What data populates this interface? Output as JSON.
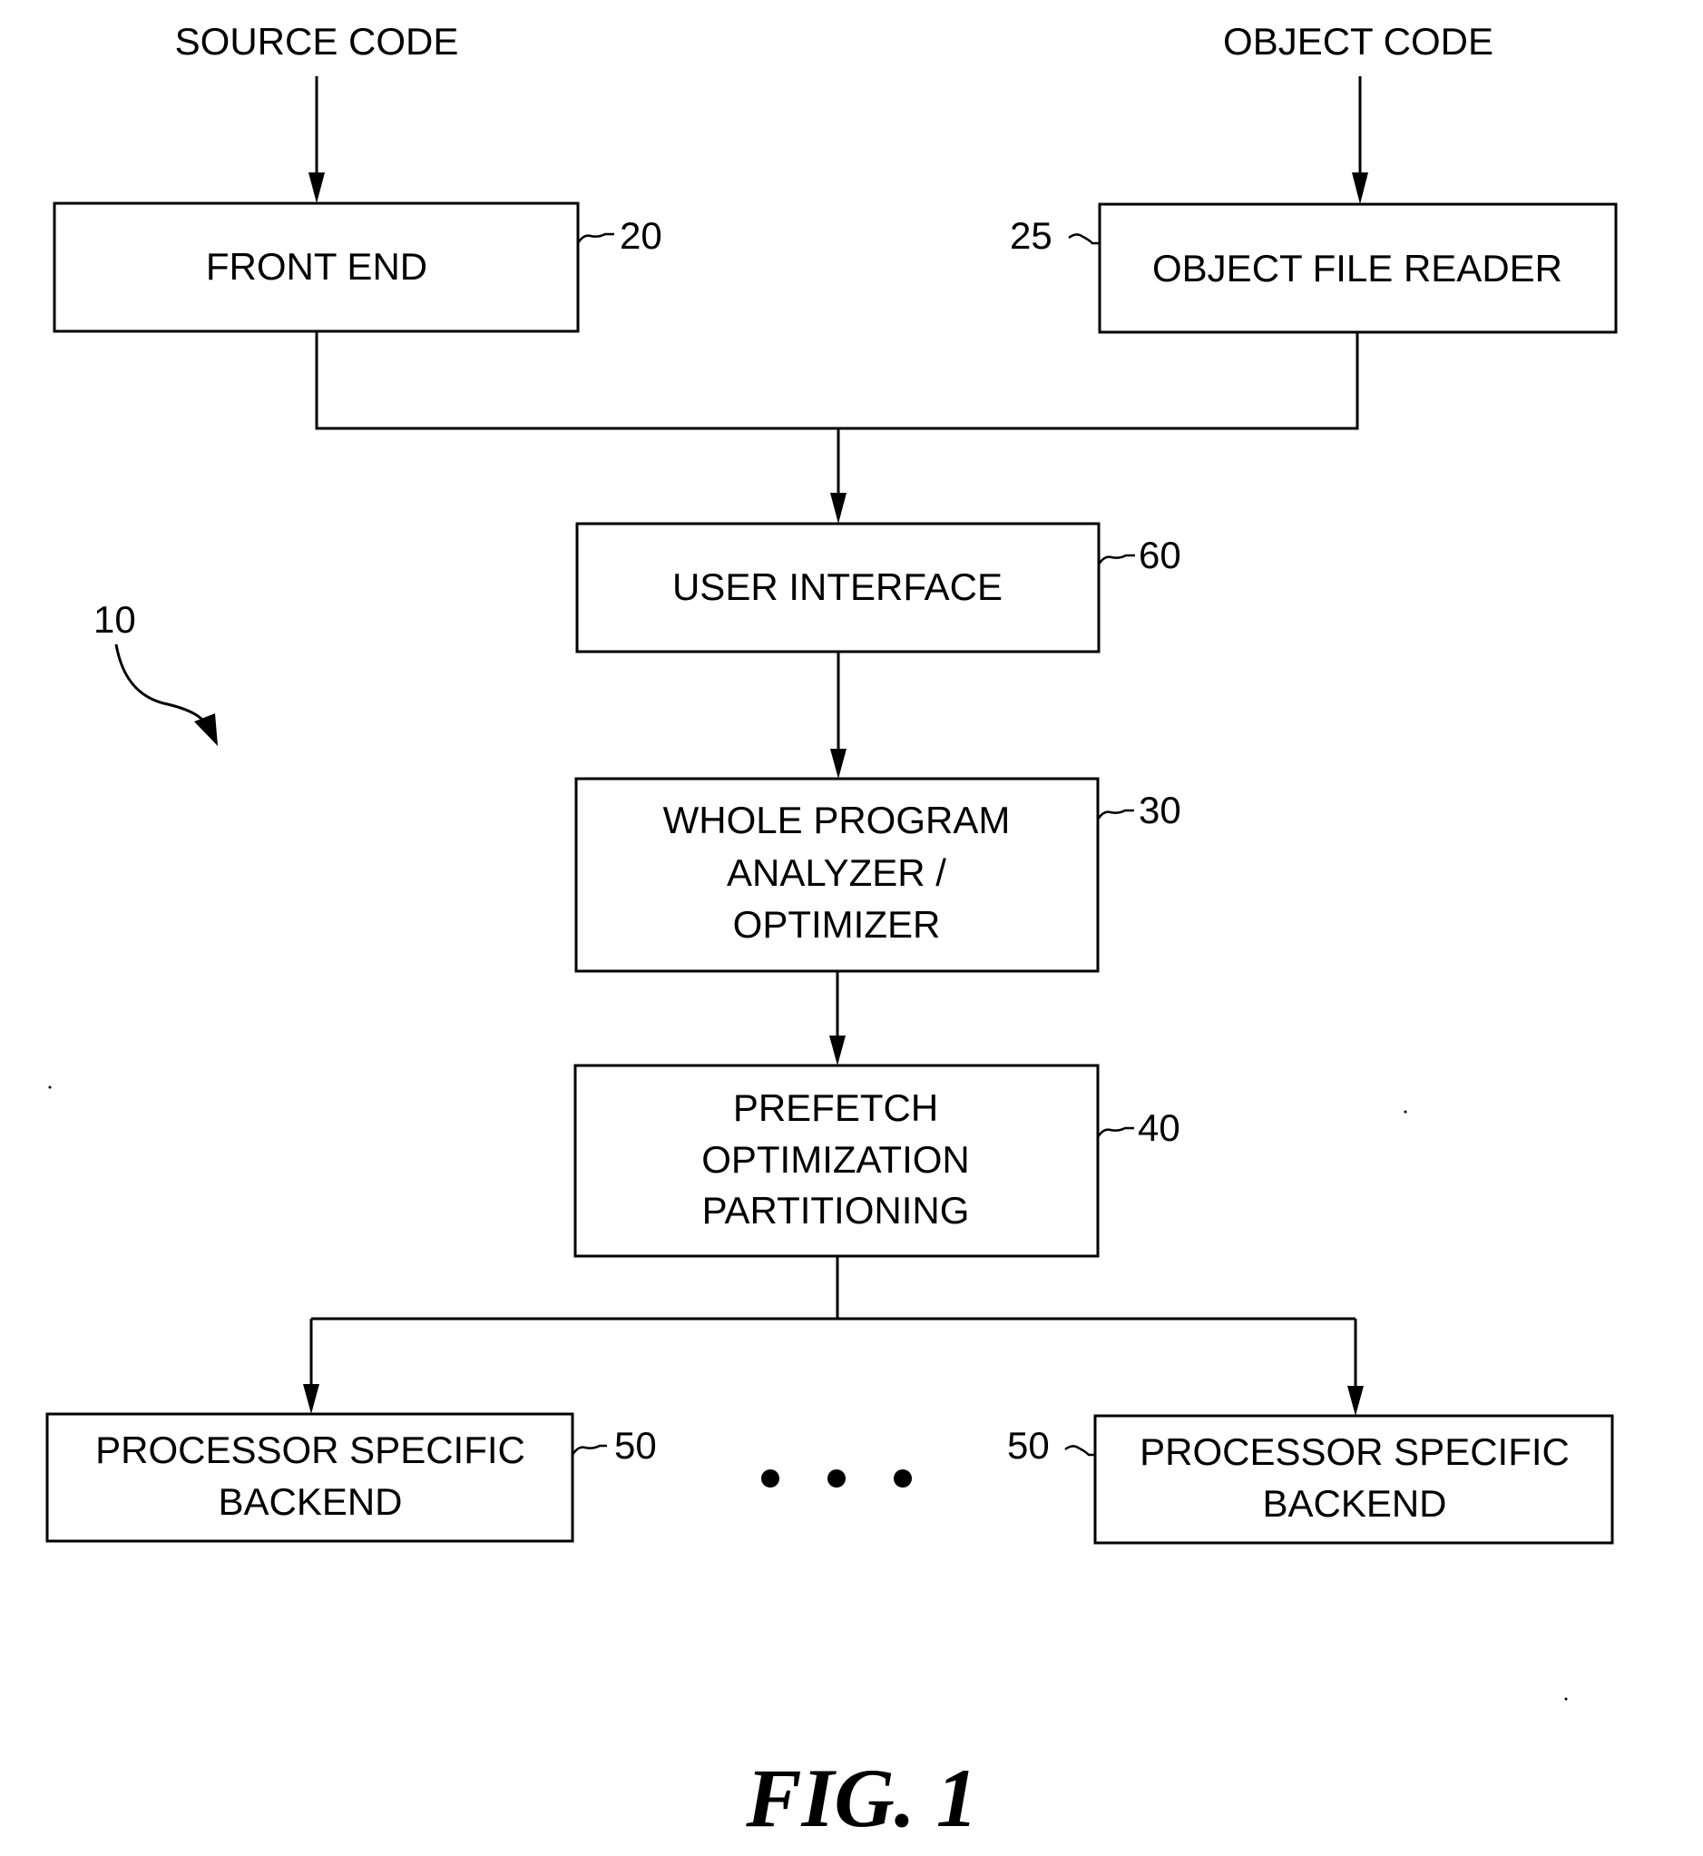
{
  "inputs": {
    "source": "SOURCE CODE",
    "object": "OBJECT CODE"
  },
  "blocks": {
    "front_end": {
      "lines": [
        "FRONT END"
      ],
      "ref": "20"
    },
    "object_file_reader": {
      "lines": [
        "OBJECT FILE READER"
      ],
      "ref": "25"
    },
    "user_interface": {
      "lines": [
        "USER INTERFACE"
      ],
      "ref": "60"
    },
    "whole_program_analyzer": {
      "lines": [
        "WHOLE PROGRAM",
        "ANALYZER /",
        "OPTIMIZER"
      ],
      "ref": "30"
    },
    "prefetch_partitioning": {
      "lines": [
        "PREFETCH",
        "OPTIMIZATION",
        "PARTITIONING"
      ],
      "ref": "40"
    },
    "backend_left": {
      "lines": [
        "PROCESSOR SPECIFIC",
        "BACKEND"
      ],
      "ref": "50"
    },
    "backend_right": {
      "lines": [
        "PROCESSOR SPECIFIC",
        "BACKEND"
      ],
      "ref": "50"
    }
  },
  "system_ref": "10",
  "ellipsis_dots": 3,
  "figure_label": "FIG. 1"
}
